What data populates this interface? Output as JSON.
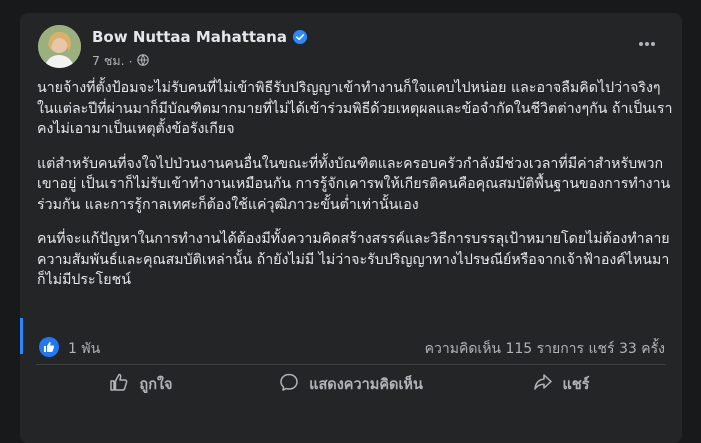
{
  "post": {
    "author": "Bow Nuttaa Mahattana",
    "time": "7 ชม.",
    "menu": "...",
    "paragraphs": [
      "นายจ้างที่ตั้งป้อมจะไม่รับคนที่ไม่เข้าพิธีรับปริญญาเข้าทำงานก็ใจแคบไปหน่อย และอาจลืมคิดไปว่าจริงๆในแต่ละปีที่ผ่านมาก็มีบัณฑิตมากมายที่ไม่ได้เข้าร่วมพิธีด้วยเหตุผลและข้อจำกัดในชีวิตต่างๆกัน ถ้าเป็นเราคงไม่เอามาเป็นเหตุตั้งข้อรังเกียจ",
      "แต่สำหรับคนที่จงใจไปป่วนงานคนอื่นในขณะที่ทั้งบัณฑิตและครอบครัวกำลังมีช่วงเวลาที่มีค่าสำหรับพวกเขาอยู่ เป็นเราก็ไม่รับเข้าทำงานเหมือนกัน การรู้จักเคารพให้เกียรติคนคือคุณสมบัติพื้นฐานของการทำงานร่วมกัน และการรู้กาลเทศะก็ต้องใช้แค่วุฒิภาวะขั้นต่ำเท่านั้นเอง",
      "คนที่จะแก้ปัญหาในการทำงานได้ต้องมีทั้งความคิดสร้างสรรค์และวิธีการบรรลุเป้าหมายโดยไม่ต้องทำลายความสัมพันธ์และคุณสมบัติเหล่านั้น ถ้ายังไม่มี ไม่ว่าจะรับปริญญาทางไปรษณีย์หรือจากเจ้าฟ้าองค์ไหนมาก็ไม่มีประโยชน์"
    ]
  },
  "stats": {
    "reactions": "1 พัน",
    "counts": "ความคิดเห็น 115 รายการ  แชร์ 33 ครั้ง"
  },
  "actions": {
    "like": "ถูกใจ",
    "comment": "แสดงความคิดเห็น",
    "share": "แชร์"
  },
  "colors": {
    "background": "#18191a",
    "card": "#242526",
    "text": "#e4e6eb",
    "secondary": "#b0b3b8",
    "accent": "#2078f4"
  }
}
